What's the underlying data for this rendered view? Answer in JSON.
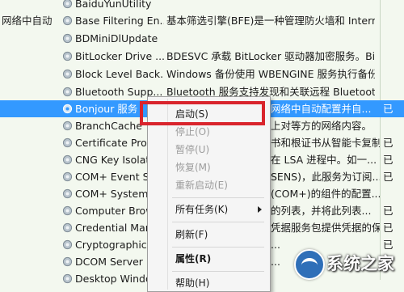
{
  "services": [
    {
      "left": "",
      "name": "BaiduYunUtility",
      "desc": "",
      "right": ""
    },
    {
      "left": "网络中自动",
      "name": "Base Filtering En...",
      "desc": "基本筛选引擎(BFE)是一种管理防火墙和 Intern...",
      "right": ""
    },
    {
      "left": "",
      "name": "BDMiniDlUpdate",
      "desc": "",
      "right": ""
    },
    {
      "left": "",
      "name": "BitLocker Drive ...",
      "desc": "BDESVC 承载 BitLocker 驱动器加密服务。Bit...",
      "right": ""
    },
    {
      "left": "",
      "name": "Block Level Back...",
      "desc": "Windows 备份使用 WBENGINE 服务执行备份...",
      "right": ""
    },
    {
      "left": "",
      "name": "Bluetooth Supp...",
      "desc": "Bluetooth 服务支持发现和关联远程 Bluetoot...",
      "right": ""
    },
    {
      "left": "",
      "name": "Bonjour 服务",
      "desc": "网络中自动配置并自...",
      "right": "已"
    },
    {
      "left": "",
      "name": "BranchCache",
      "desc": "上对等方的网络内容。",
      "right": ""
    },
    {
      "left": "",
      "name": "Certificate Prop",
      "desc": "书和根证书从智能卡复制到当前用户...",
      "right": "已"
    },
    {
      "left": "",
      "name": "CNG Key Isolati",
      "desc": "在 LSA 进程中。如一...",
      "right": "已"
    },
    {
      "left": "",
      "name": "COM+ Event Sy",
      "desc": "SENS)，此服务为订阅...",
      "right": "已"
    },
    {
      "left": "",
      "name": "COM+ System",
      "desc": "(COM+)的组件的配置...",
      "right": ""
    },
    {
      "left": "",
      "name": "Computer Brow",
      "desc": "的列表，并将此列表...",
      "right": "已"
    },
    {
      "left": "",
      "name": "Credential Man",
      "desc": "凭据服务包提供凭据的保...",
      "right": "已"
    },
    {
      "left": "",
      "name": "Cryptographic S",
      "desc": "...",
      "right": "已"
    },
    {
      "left": "",
      "name": "DCOM Server P",
      "desc": "...",
      "right": "已"
    },
    {
      "left": "",
      "name": "Desktop Windo",
      "desc": "",
      "right": ""
    }
  ],
  "context_menu": {
    "start": "启动(S)",
    "stop": "停止(O)",
    "pause": "暂停(U)",
    "resume": "恢复(M)",
    "restart": "重新启动(E)",
    "all_tasks": "所有任务(K)",
    "refresh": "刷新(F)",
    "properties": "属性(R)",
    "help": "帮助(H)"
  },
  "watermark": {
    "text": "系统之家"
  },
  "colors": {
    "selected": "#3399ff",
    "highlight_border": "#d9242c",
    "background": "#f3f8ef"
  }
}
